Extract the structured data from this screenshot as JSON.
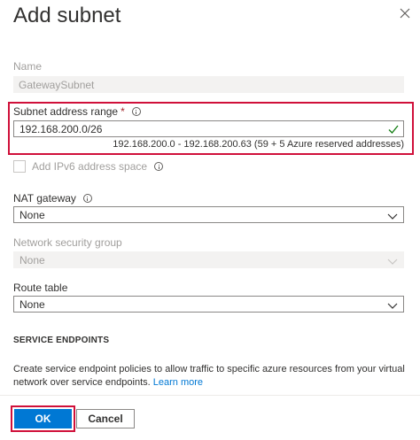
{
  "panel": {
    "title": "Add subnet"
  },
  "fields": {
    "name": {
      "label": "Name",
      "value": "GatewaySubnet"
    },
    "subnet_range": {
      "label": "Subnet address range",
      "required_mark": "*",
      "value": "192.168.200.0/26",
      "hint": "192.168.200.0 - 192.168.200.63 (59 + 5 Azure reserved addresses)"
    },
    "ipv6": {
      "label": "Add IPv6 address space"
    },
    "nat_gateway": {
      "label": "NAT gateway",
      "value": "None"
    },
    "nsg": {
      "label": "Network security group",
      "value": "None"
    },
    "route_table": {
      "label": "Route table",
      "value": "None"
    }
  },
  "service_endpoints": {
    "header": "SERVICE ENDPOINTS",
    "description": "Create service endpoint policies to allow traffic to specific azure resources from your virtual network over service endpoints.",
    "learn_more": "Learn more"
  },
  "buttons": {
    "ok": "OK",
    "cancel": "Cancel"
  },
  "colors": {
    "primary": "#0078d4",
    "highlight": "#d0103a",
    "valid_check": "#107c10"
  }
}
